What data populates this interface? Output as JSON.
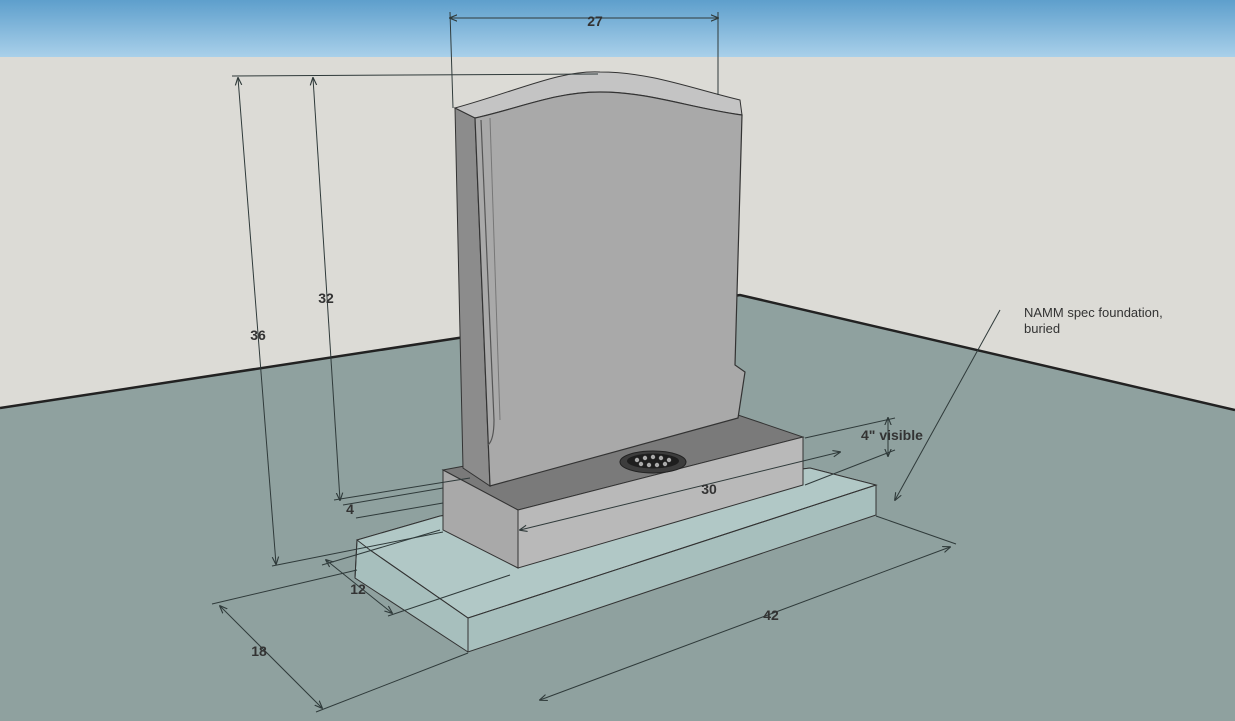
{
  "dimensions": {
    "headstone_width": "27",
    "overall_height": "36",
    "tablet_height": "32",
    "tablet_setback": "4",
    "base_width": "30",
    "base_depth": "12",
    "foundation_depth": "18",
    "foundation_width": "42",
    "base_visible": "4\" visible"
  },
  "annotation": {
    "line1": "NAMM spec foundation,",
    "line2": "buried"
  },
  "colors": {
    "sky": "#7ab3d6",
    "wall": "#dcdbd6",
    "ground": "#8fa19f",
    "stone_face": "#a9a9a9",
    "stone_side": "#8c8c8c",
    "stone_top": "#c4c4c4",
    "base_front": "#b9b9b9",
    "base_top": "#7a7a7a",
    "foundation": "#a7bfbd"
  }
}
